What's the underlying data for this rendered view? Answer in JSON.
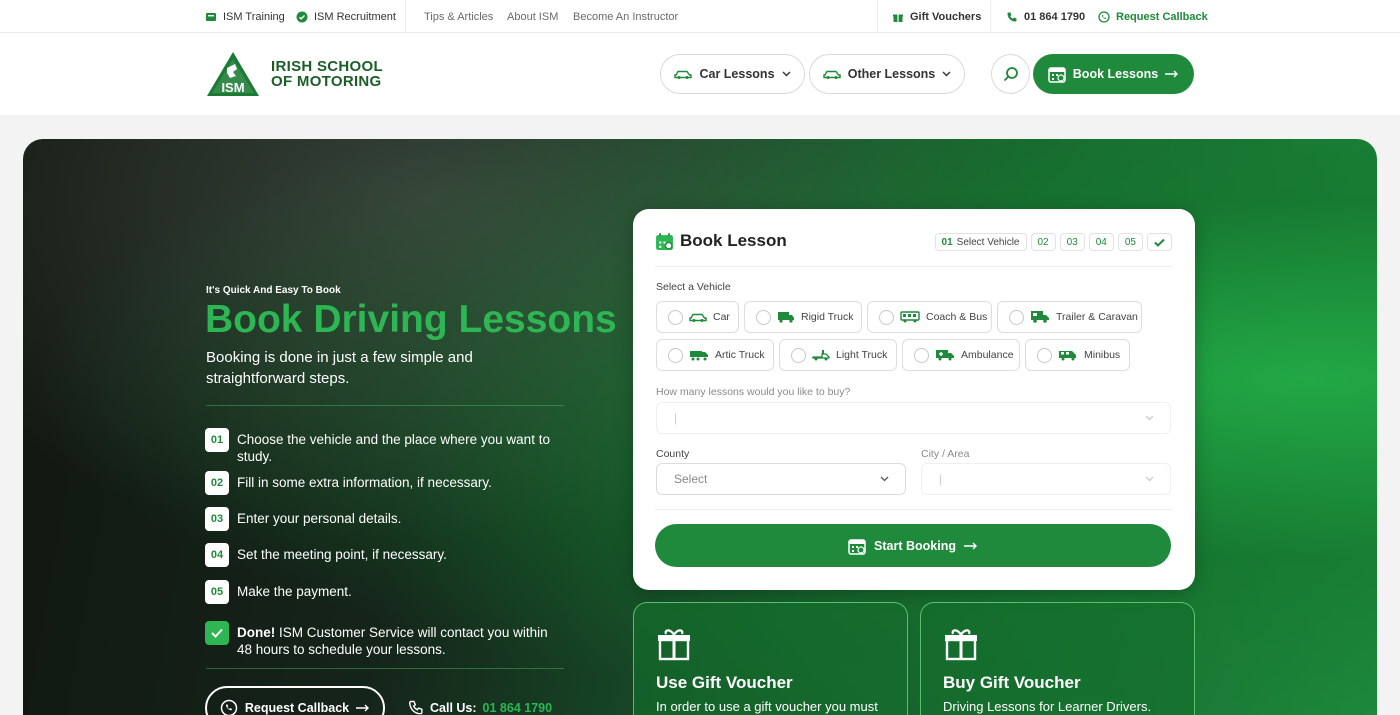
{
  "topbar": {
    "training": "ISM Training",
    "recruitment": "ISM Recruitment",
    "tips": "Tips & Articles",
    "about": "About ISM",
    "instructor": "Become An Instructor",
    "gift_vouchers": "Gift Vouchers",
    "phone": "01 864 1790",
    "callback": "Request Callback"
  },
  "header": {
    "logo_line1": "IRISH SCHOOL",
    "logo_line2": "OF MOTORING",
    "logo_badge": "ISM",
    "car_lessons": "Car Lessons",
    "other_lessons": "Other Lessons",
    "book_lessons": "Book Lessons"
  },
  "hero": {
    "eyebrow": "It's Quick And Easy To Book",
    "title": "Book Driving Lessons",
    "subtitle": "Booking is done in just a few simple and straightforward steps.",
    "steps": [
      {
        "num": "01",
        "text": "Choose the vehicle and the place where you want to study."
      },
      {
        "num": "02",
        "text": "Fill in some extra information, if necessary."
      },
      {
        "num": "03",
        "text": "Enter your personal details."
      },
      {
        "num": "04",
        "text": "Set the meeting point, if necessary."
      },
      {
        "num": "05",
        "text": "Make the payment."
      }
    ],
    "done_bold": "Done!",
    "done_text": " ISM Customer Service will contact you within 48 hours to schedule your lessons.",
    "callback_button": "Request Callback",
    "call_label": "Call Us:",
    "call_number": "01 864 1790"
  },
  "booking": {
    "title": "Book Lesson",
    "stepper": {
      "current_num": "01",
      "current_label": "Select Vehicle",
      "others": [
        "02",
        "03",
        "04",
        "05"
      ]
    },
    "vehicle_label": "Select a Vehicle",
    "vehicles": [
      "Car",
      "Rigid Truck",
      "Coach & Bus",
      "Trailer & Caravan",
      "Artic Truck",
      "Light Truck",
      "Ambulance",
      "Minibus"
    ],
    "lessons_label": "How many lessons would you like to buy?",
    "lessons_value": "|",
    "county_label": "County",
    "county_placeholder": "Select",
    "city_label": "City / Area",
    "city_value": "|",
    "start_button": "Start Booking"
  },
  "gifts": [
    {
      "title": "Use Gift Voucher",
      "desc": "In order to use a gift voucher you must"
    },
    {
      "title": "Buy Gift Voucher",
      "desc": "Driving Lessons for Learner Drivers."
    }
  ],
  "colors": {
    "brand_green": "#1f8a3b",
    "accent_green": "#2eb554"
  }
}
